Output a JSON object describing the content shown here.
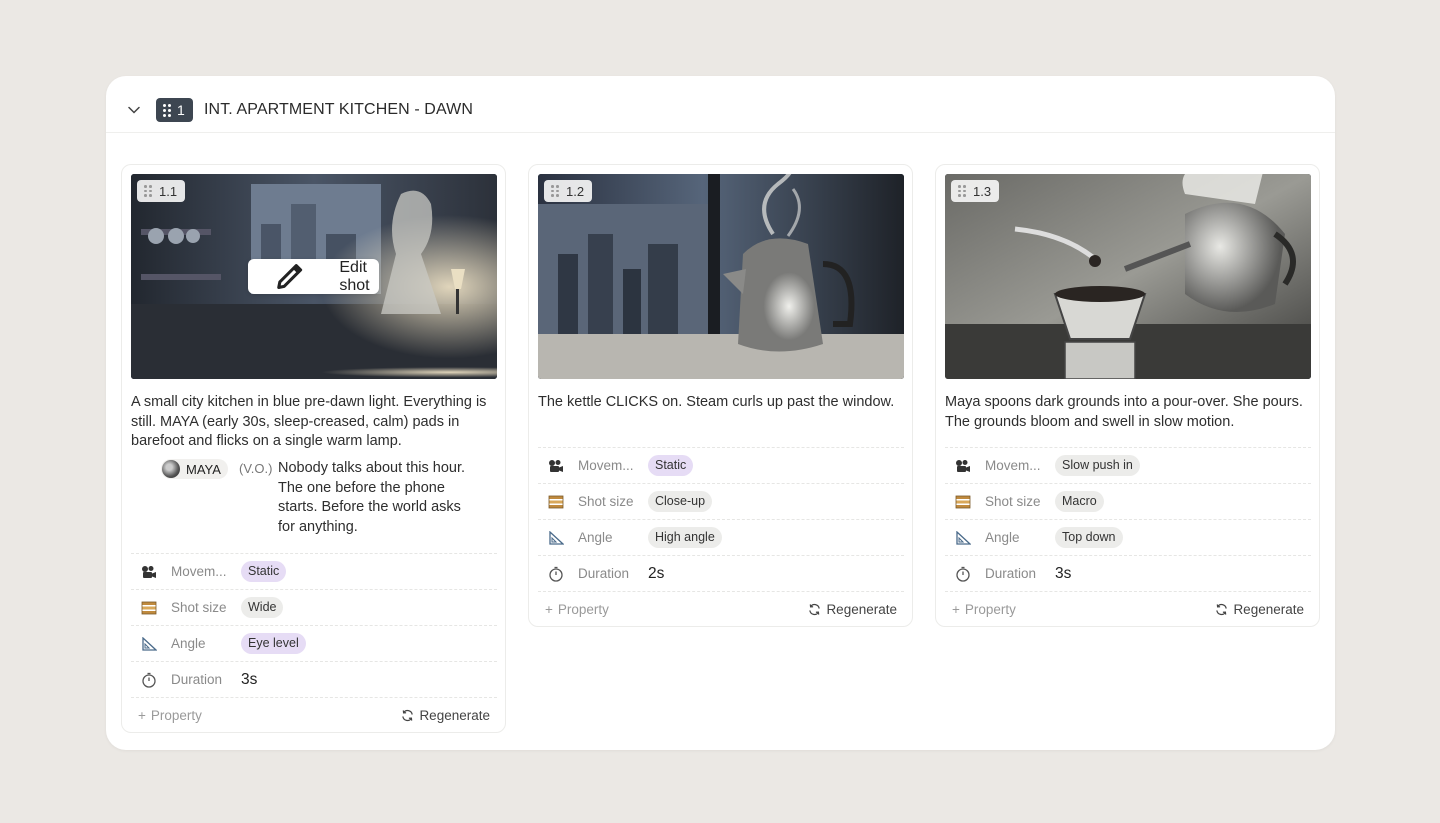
{
  "scene": {
    "number": "1",
    "title": "INT. APARTMENT KITCHEN - DAWN"
  },
  "edit_shot_label": "Edit shot",
  "shots": [
    {
      "id": "1.1",
      "description": "A small city kitchen in blue pre-dawn light. Everything is still. MAYA (early 30s, sleep-creased, calm) pads in barefoot and flicks on a single warm lamp.",
      "dialogue": {
        "character": "MAYA",
        "extension": "(V.O.)",
        "line": "Nobody talks about this hour. The one before the phone starts. Before the world asks for anything."
      },
      "properties": {
        "movement_label": "Movem...",
        "movement": "Static",
        "shot_size_label": "Shot size",
        "shot_size": "Wide",
        "angle_label": "Angle",
        "angle": "Eye level",
        "duration_label": "Duration",
        "duration": "3s"
      },
      "add_property": "Property",
      "regenerate": "Regenerate"
    },
    {
      "id": "1.2",
      "description": "The kettle CLICKS on. Steam curls up past the window.",
      "properties": {
        "movement_label": "Movem...",
        "movement": "Static",
        "shot_size_label": "Shot size",
        "shot_size": "Close-up",
        "angle_label": "Angle",
        "angle": "High angle",
        "duration_label": "Duration",
        "duration": "2s"
      },
      "add_property": "Property",
      "regenerate": "Regenerate"
    },
    {
      "id": "1.3",
      "description": "Maya spoons dark grounds into a pour-over. She pours. The grounds bloom and swell in slow motion.",
      "properties": {
        "movement_label": "Movem...",
        "movement": "Slow push in",
        "shot_size_label": "Shot size",
        "shot_size": "Macro",
        "angle_label": "Angle",
        "angle": "Top down",
        "duration_label": "Duration",
        "duration": "3s"
      },
      "add_property": "Property",
      "regenerate": "Regenerate"
    }
  ]
}
